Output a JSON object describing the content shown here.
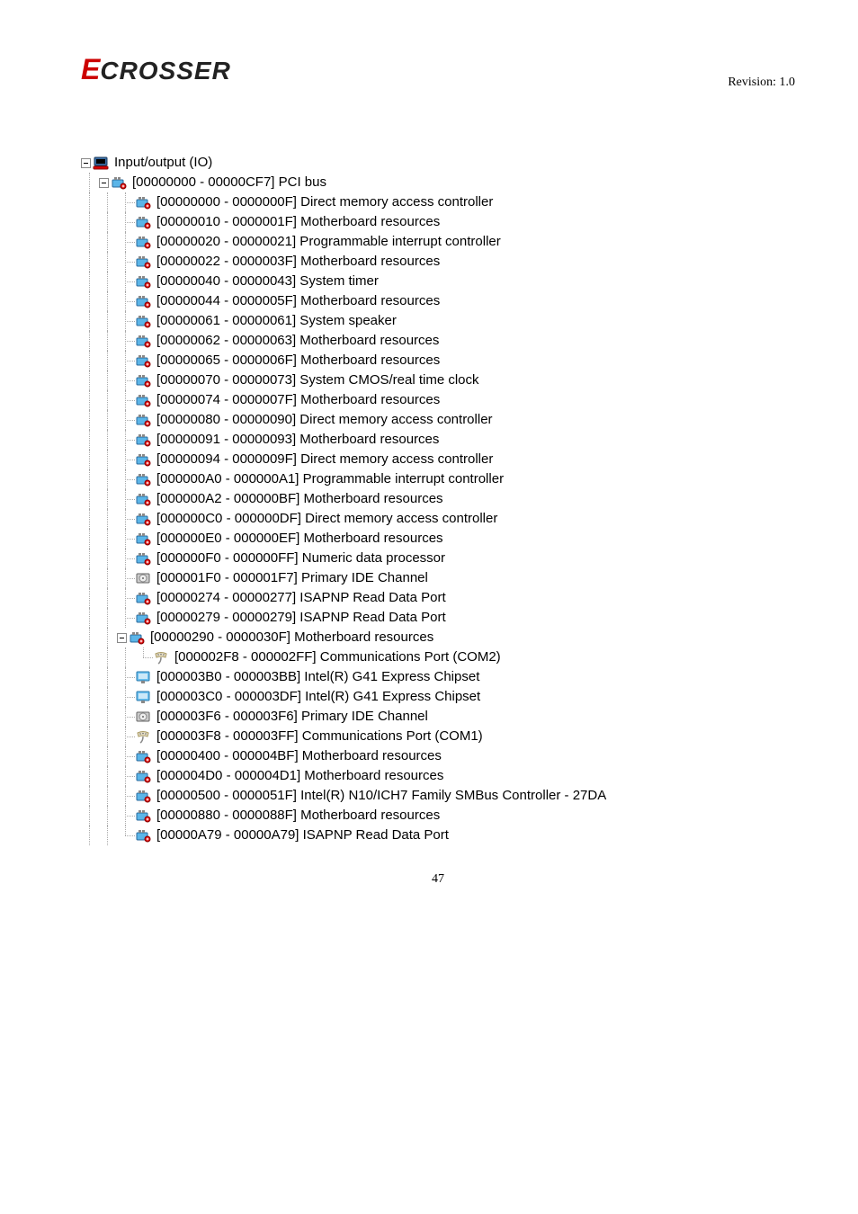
{
  "header": {
    "logo_e": "E",
    "logo_text": "CROSSER",
    "revision": "Revision: 1.0"
  },
  "root": {
    "label": "Input/output (IO)",
    "icon": "computer"
  },
  "pci": {
    "label": "[00000000 - 00000CF7]  PCI bus",
    "icon": "device"
  },
  "items": [
    {
      "label": "[00000000 - 0000000F]  Direct memory access controller",
      "icon": "device"
    },
    {
      "label": "[00000010 - 0000001F]  Motherboard resources",
      "icon": "device"
    },
    {
      "label": "[00000020 - 00000021]  Programmable interrupt controller",
      "icon": "device"
    },
    {
      "label": "[00000022 - 0000003F]  Motherboard resources",
      "icon": "device"
    },
    {
      "label": "[00000040 - 00000043]  System timer",
      "icon": "device"
    },
    {
      "label": "[00000044 - 0000005F]  Motherboard resources",
      "icon": "device"
    },
    {
      "label": "[00000061 - 00000061]  System speaker",
      "icon": "device"
    },
    {
      "label": "[00000062 - 00000063]  Motherboard resources",
      "icon": "device"
    },
    {
      "label": "[00000065 - 0000006F]  Motherboard resources",
      "icon": "device"
    },
    {
      "label": "[00000070 - 00000073]  System CMOS/real time clock",
      "icon": "device"
    },
    {
      "label": "[00000074 - 0000007F]  Motherboard resources",
      "icon": "device"
    },
    {
      "label": "[00000080 - 00000090]  Direct memory access controller",
      "icon": "device"
    },
    {
      "label": "[00000091 - 00000093]  Motherboard resources",
      "icon": "device"
    },
    {
      "label": "[00000094 - 0000009F]  Direct memory access controller",
      "icon": "device"
    },
    {
      "label": "[000000A0 - 000000A1]  Programmable interrupt controller",
      "icon": "device"
    },
    {
      "label": "[000000A2 - 000000BF]  Motherboard resources",
      "icon": "device"
    },
    {
      "label": "[000000C0 - 000000DF]  Direct memory access controller",
      "icon": "device"
    },
    {
      "label": "[000000E0 - 000000EF]  Motherboard resources",
      "icon": "device"
    },
    {
      "label": "[000000F0 - 000000FF]  Numeric data processor",
      "icon": "device"
    },
    {
      "label": "[000001F0 - 000001F7]  Primary IDE Channel",
      "icon": "disk"
    },
    {
      "label": "[00000274 - 00000277]  ISAPNP Read Data Port",
      "icon": "device"
    },
    {
      "label": "[00000279 - 00000279]  ISAPNP Read Data Port",
      "icon": "device"
    }
  ],
  "mb_res": {
    "label": "[00000290 - 0000030F]  Motherboard resources",
    "icon": "device",
    "child": {
      "label": "[000002F8 - 000002FF]  Communications Port (COM2)",
      "icon": "port"
    }
  },
  "items2": [
    {
      "label": "[000003B0 - 000003BB]  Intel(R) G41 Express Chipset",
      "icon": "display"
    },
    {
      "label": "[000003C0 - 000003DF]  Intel(R) G41 Express Chipset",
      "icon": "display"
    },
    {
      "label": "[000003F6 - 000003F6]  Primary IDE Channel",
      "icon": "disk"
    },
    {
      "label": "[000003F8 - 000003FF]  Communications Port (COM1)",
      "icon": "port"
    },
    {
      "label": "[00000400 - 000004BF]  Motherboard resources",
      "icon": "device"
    },
    {
      "label": "[000004D0 - 000004D1]  Motherboard resources",
      "icon": "device"
    },
    {
      "label": "[00000500 - 0000051F]  Intel(R) N10/ICH7 Family SMBus Controller - 27DA",
      "icon": "device"
    },
    {
      "label": "[00000880 - 0000088F]  Motherboard resources",
      "icon": "device"
    },
    {
      "label": "[00000A79 - 00000A79]  ISAPNP Read Data Port",
      "icon": "device"
    }
  ],
  "pagenum": "47",
  "icon_svgs": {
    "computer": "<svg width='18' height='18' viewBox='0 0 18 18'><rect x='2' y='3' width='14' height='9' rx='1' fill='#3b6ea5' stroke='#1a3a5c'/><rect x='4' y='5' width='10' height='5' fill='#000'/><rect x='1' y='13' width='16' height='3' rx='1' fill='#d00' stroke='#800'/></svg>",
    "device": "<svg width='18' height='18' viewBox='0 0 18 18'><rect x='2' y='6' width='12' height='8' rx='1' fill='#5bb5e8' stroke='#2a6a9c'/><rect x='4' y='3' width='3' height='3' fill='#888'/><rect x='8' y='3' width='3' height='3' fill='#888'/><circle cx='14' cy='13' r='3' fill='#d00' stroke='#800'/><rect x='12.5' y='12.5' width='3' height='1' fill='#fff'/><rect x='13.5' y='11.5' width='1' height='3' fill='#fff'/></svg>",
    "disk": "<svg width='18' height='18' viewBox='0 0 18 18'><rect x='2' y='4' width='14' height='10' rx='1' fill='#ccc' stroke='#666'/><circle cx='9' cy='9' r='4' fill='#eee' stroke='#888'/><circle cx='9' cy='9' r='1' fill='#666'/></svg>",
    "display": "<svg width='18' height='18' viewBox='0 0 18 18'><rect x='2' y='3' width='14' height='10' rx='1' fill='#6bc0f0' stroke='#2a7aac'/><rect x='4' y='5' width='10' height='6' fill='#cce8f8'/><rect x='7' y='13' width='4' height='3' fill='#888'/></svg>",
    "port": "<svg width='18' height='18' viewBox='0 0 18 18'><path d='M3 5 Q9 2 15 5 L14 9 Q9 7 4 9 Z' fill='#e8e0c8' stroke='#a89860'/><circle cx='6' cy='6' r='0.8' fill='#666'/><circle cx='9' cy='5.5' r='0.8' fill='#666'/><circle cx='12' cy='6' r='0.8' fill='#666'/><path d='M9 9 Q9 14 6 16' stroke='#888' stroke-width='1.5' fill='none'/></svg>"
  }
}
